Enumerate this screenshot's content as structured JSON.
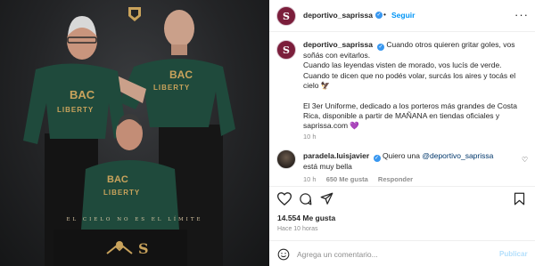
{
  "post": {
    "account": {
      "username": "deportivo_saprissa",
      "avatar_letter": "S",
      "verified_mark": "✓",
      "separator": "•",
      "follow_label": "Seguir",
      "more_glyph": "···"
    },
    "caption": {
      "username": "deportivo_saprissa",
      "line1": "Cuando otros quieren gritar goles, vos soñás con evitarlos.",
      "line2": "Cuando las leyendas visten de morado, vos lucís de verde.",
      "line3": "Cuando te dicen que no podés volar, surcás los aires y tocás el cielo 🦅",
      "line4": "El 3er Uniforme, dedicado a los porteros más grandes de Costa Rica, disponible a partir de MAÑANA en tiendas oficiales y saprissa.com 💜",
      "time": "10 h"
    },
    "comment": {
      "username": "paradela.luisjavier",
      "mention": "@deportivo_saprissa",
      "text_before": "Quiero una",
      "text_after": "está muy bella",
      "time": "10 h",
      "likes": "650 Me gusta",
      "reply_label": "Responder"
    },
    "likes_total": "14.554 Me gusta",
    "posted_ago": "Hace 10 horas",
    "composer": {
      "placeholder": "Agrega un comentario...",
      "publish_label": "Publicar"
    },
    "image": {
      "tagline": "EL CIELO NO ES EL LÍMITE",
      "jersey_sponsor_1": "BAC",
      "jersey_sponsor_2": "LIBERTY",
      "club_letter": "S",
      "colors": {
        "jersey_green": "#1f4a3c",
        "gold": "#c9a35c",
        "background": "#232426",
        "club_purple": "#7b1e3b"
      }
    },
    "icons": [
      "heart-icon",
      "comment-icon",
      "share-icon",
      "bookmark-icon",
      "emoji-icon",
      "more-icon",
      "verified-icon"
    ]
  }
}
